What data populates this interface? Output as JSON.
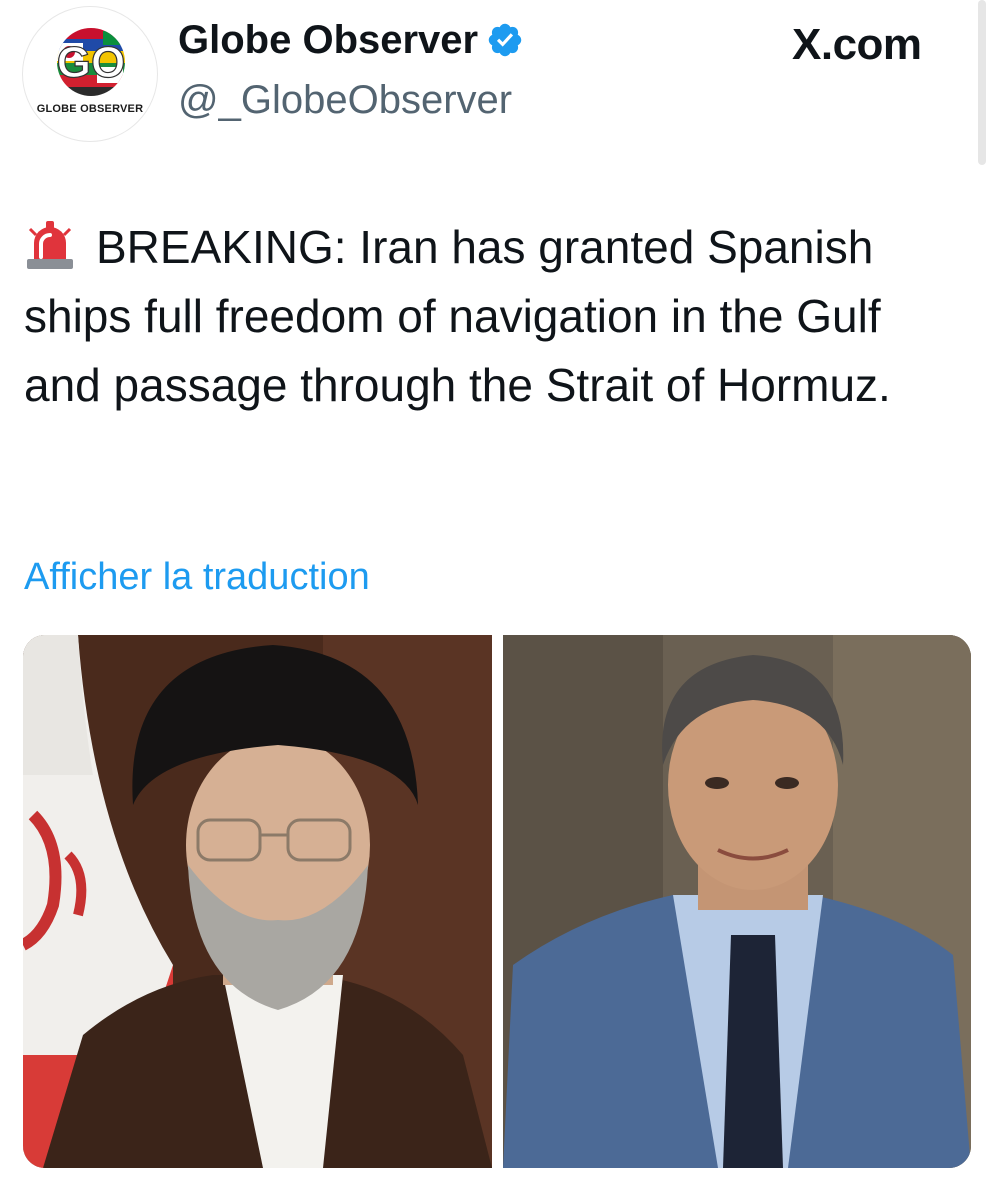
{
  "account": {
    "display_name": "Globe Observer",
    "handle": "@_GlobeObserver",
    "avatar_label": "GLOBE OBSERVER",
    "avatar_monogram": "GO",
    "verified": true,
    "verified_color": "#1d9bf0"
  },
  "brand": {
    "site": "X.com"
  },
  "post": {
    "text": "BREAKING: Iran has granted Spanish ships full freedom of navigation in the Gulf and passage through the Strait of Hormuz.",
    "leading_emoji": "rotating-light-icon",
    "translate_link": "Afficher la traduction",
    "link_color": "#1d9bf0"
  },
  "media": {
    "images": [
      {
        "subject": "cleric-portrait-with-iran-flag"
      },
      {
        "subject": "man-in-blue-suit-portrait"
      }
    ]
  }
}
